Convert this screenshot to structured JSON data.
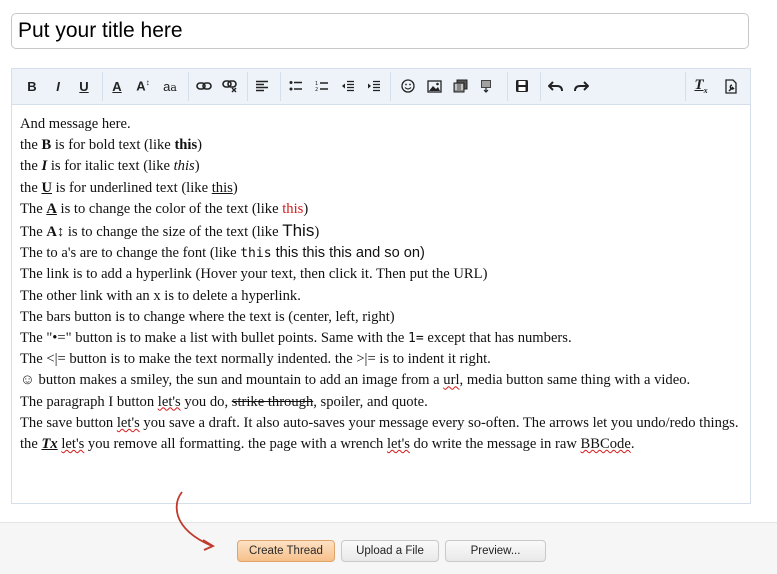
{
  "title_field": {
    "value": "Put your title here"
  },
  "toolbar": {
    "bold_label": "B",
    "italic_label": "I",
    "underline_label": "U",
    "color_label": "A",
    "size_label": "A",
    "font_label": "a",
    "clear_format_label": "T"
  },
  "message": {
    "intro": "And message here.",
    "bold_line": {
      "a": "the ",
      "icon": "B",
      "b": " is for bold text (like ",
      "ex": "this",
      "c": ")"
    },
    "italic_line": {
      "a": "the ",
      "icon": "I",
      "b": " is for italic text (like ",
      "ex": "this",
      "c": ")"
    },
    "underline_line": {
      "a": "the ",
      "icon": "U",
      "b": " is for underlined text (like ",
      "ex": "this",
      "c": ")"
    },
    "color_line": {
      "a": "The ",
      "icon": "A",
      "b": " is to change the color of the text (like ",
      "ex": "this",
      "c": ")"
    },
    "size_line": {
      "a": "The ",
      "icon": "A↕",
      "b": " is to change the size of the text (like ",
      "ex": "This",
      "c": ")"
    },
    "font_line": {
      "a": "The to a's are to change the font (like ",
      "ex1": "this",
      "ex2": " this this this and so on)"
    },
    "link_line": "The link is to add a hyperlink (Hover your text, then click it. Then put the URL)",
    "unlink_line": "The other link with an x is to delete a hyperlink.",
    "bars_line": "The bars button is to change where the text is (center, left, right)",
    "bullet_line": {
      "a": "The \"•=\" button is to make a list with bullet points. Same with the ",
      "num": "1=",
      "b": " except that has numbers."
    },
    "indent_line": "The <|= button is to make the text normally indented. the >|= is to indent it right.",
    "smiley_line": {
      "a": "☺ button makes a smiley, the sun and mountain to add an image from a ",
      "url": "url",
      "b": ", media button same thing with a video."
    },
    "paragraph_line": {
      "a": "The paragraph I button ",
      "lets": "let's",
      "b": " you do, ",
      "strike": "strike through",
      "c": ", spoiler, and quote."
    },
    "save_line": {
      "a": "The save button ",
      "lets": "let's",
      "b": " you save a draft. It also auto-saves your message every so-often. The arrows let you undo/redo things. the ",
      "tx": "Tx",
      "c": " ",
      "lets2": "let's",
      "d": " you remove all formatting. the page with a wrench ",
      "lets3": "let's",
      "e": " do write the message in raw ",
      "bbcode": "BBCode",
      "f": "."
    }
  },
  "buttons": {
    "create": "Create Thread",
    "upload": "Upload a File",
    "preview": "Preview..."
  },
  "colors": {
    "accent_red": "#d81818",
    "toolbar_bg": "#edf3f9",
    "primary_button": "#f6c08a"
  }
}
